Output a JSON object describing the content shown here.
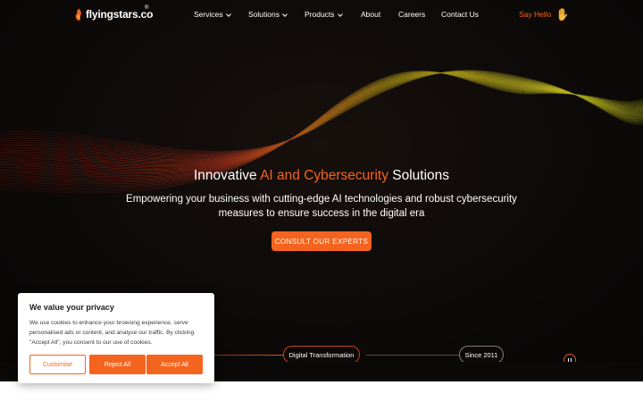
{
  "header": {
    "logo_text": "flyingstars.co",
    "logo_reg": "®",
    "nav": [
      {
        "label": "Services",
        "has_dropdown": true
      },
      {
        "label": "Solutions",
        "has_dropdown": true
      },
      {
        "label": "Products",
        "has_dropdown": true
      },
      {
        "label": "About",
        "has_dropdown": false
      },
      {
        "label": "Careers",
        "has_dropdown": false
      },
      {
        "label": "Contact Us",
        "has_dropdown": false
      }
    ],
    "say_hello": "Say Hello",
    "say_hello_icon": "waving-hand-icon"
  },
  "hero": {
    "title_pre": "Innovative ",
    "title_accent": "AI and Cybersecurity",
    "title_post": " Solutions",
    "subtitle": "Empowering your business with cutting-edge AI technologies and robust cybersecurity measures to ensure success in the digital era",
    "cta": "CONSULT OUR EXPERTS"
  },
  "timeline": {
    "items": [
      "Digital Transformation",
      "Since 2011"
    ],
    "pause_icon": "pause-icon"
  },
  "cookie": {
    "title": "We value your privacy",
    "text": "We use cookies to enhance your browsing experience, serve personalised ads or content, and analyse our traffic. By clicking \"Accept All\", you consent to our use of cookies.",
    "customise": "Customise",
    "reject": "Reject All",
    "accept": "Accept All"
  },
  "colors": {
    "accent": "#f5641e",
    "hero_bg": "#0d0a09",
    "text": "#ffffff"
  }
}
